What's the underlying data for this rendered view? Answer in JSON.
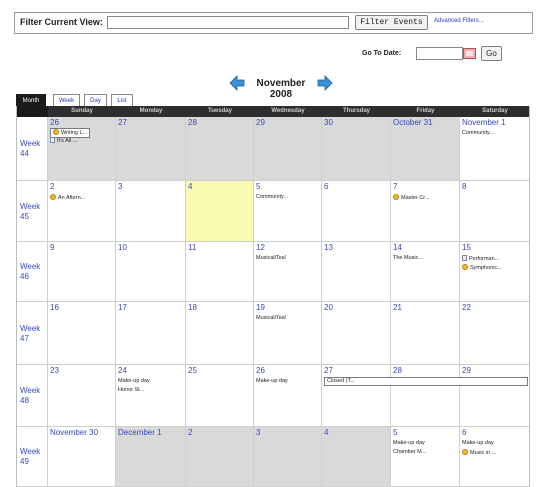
{
  "filter": {
    "label": "Filter Current View:",
    "input_value": "",
    "button_label": "Filter Events",
    "advanced_link": "Advanced Filters..."
  },
  "goto": {
    "label": "Go To Date:",
    "input_value": "",
    "button_label": "Go"
  },
  "month": {
    "title": "November 2008",
    "prev_icon": "arrow-left-icon",
    "next_icon": "arrow-right-icon"
  },
  "tabs": [
    "Month",
    "Week",
    "Day",
    "List"
  ],
  "day_headers": [
    "Sunday",
    "Monday",
    "Tuesday",
    "Wednesday",
    "Thursday",
    "Friday",
    "Saturday"
  ],
  "weeks": [
    {
      "label": "Week 44",
      "days": [
        {
          "date": "26",
          "events": [
            {
              "text": "Writing L...",
              "icon": "clock"
            },
            {
              "text": "It's All ...",
              "icon": "page"
            }
          ]
        },
        {
          "date": "27",
          "events": []
        },
        {
          "date": "28",
          "events": []
        },
        {
          "date": "29",
          "events": []
        },
        {
          "date": "30",
          "events": []
        },
        {
          "date": "October 31",
          "events": []
        },
        {
          "date": "November 1",
          "events": [
            {
              "text": "Community...",
              "icon": ""
            }
          ]
        }
      ]
    },
    {
      "label": "Week 45",
      "days": [
        {
          "date": "2",
          "events": [
            {
              "text": "An Aftern...",
              "icon": "clock"
            }
          ]
        },
        {
          "date": "3",
          "events": []
        },
        {
          "date": "4",
          "events": []
        },
        {
          "date": "5",
          "events": [
            {
              "text": "Community...",
              "icon": ""
            }
          ]
        },
        {
          "date": "6",
          "events": []
        },
        {
          "date": "7",
          "events": [
            {
              "text": "Master Cr...",
              "icon": "clock"
            }
          ]
        },
        {
          "date": "8",
          "events": []
        }
      ]
    },
    {
      "label": "Week 46",
      "days": [
        {
          "date": "9",
          "events": []
        },
        {
          "date": "10",
          "events": []
        },
        {
          "date": "11",
          "events": []
        },
        {
          "date": "12",
          "events": [
            {
              "text": "MusicaliTea!",
              "icon": ""
            }
          ]
        },
        {
          "date": "13",
          "events": []
        },
        {
          "date": "14",
          "events": [
            {
              "text": "The Music...",
              "icon": ""
            }
          ]
        },
        {
          "date": "15",
          "events": [
            {
              "text": "Performan...",
              "icon": "page"
            },
            {
              "text": "Symphonic...",
              "icon": "clock"
            }
          ]
        }
      ]
    },
    {
      "label": "Week 47",
      "days": [
        {
          "date": "16",
          "events": []
        },
        {
          "date": "17",
          "events": []
        },
        {
          "date": "18",
          "events": []
        },
        {
          "date": "19",
          "events": [
            {
              "text": "MusicaliTea!",
              "icon": ""
            }
          ]
        },
        {
          "date": "20",
          "events": []
        },
        {
          "date": "21",
          "events": []
        },
        {
          "date": "22",
          "events": []
        }
      ]
    },
    {
      "label": "Week 48",
      "days": [
        {
          "date": "23",
          "events": []
        },
        {
          "date": "24",
          "events": [
            {
              "text": "Make-up day",
              "icon": ""
            },
            {
              "text": "Honor St...",
              "icon": ""
            }
          ]
        },
        {
          "date": "25",
          "events": []
        },
        {
          "date": "26",
          "events": [
            {
              "text": "Make-up day",
              "icon": ""
            }
          ]
        },
        {
          "date": "27",
          "events": []
        },
        {
          "date": "28",
          "events": []
        },
        {
          "date": "29",
          "events": []
        }
      ],
      "span_event": {
        "text": "Closed (T..."
      }
    },
    {
      "label": "Week 49",
      "days": [
        {
          "date": "November 30",
          "events": []
        },
        {
          "date": "December 1",
          "events": []
        },
        {
          "date": "2",
          "events": []
        },
        {
          "date": "3",
          "events": []
        },
        {
          "date": "4",
          "events": []
        },
        {
          "date": "5",
          "events": [
            {
              "text": "Make-up day",
              "icon": ""
            },
            {
              "text": "Chamber M...",
              "icon": ""
            }
          ]
        },
        {
          "date": "6",
          "events": [
            {
              "text": "Make-up day",
              "icon": ""
            },
            {
              "text": "Music in ...",
              "icon": "clock"
            }
          ]
        }
      ]
    }
  ],
  "colors": {
    "accent": "#3848b8",
    "out_of_month": "#d9d9d9",
    "today": "#fafab3",
    "header_bg": "#2e2e2e"
  }
}
